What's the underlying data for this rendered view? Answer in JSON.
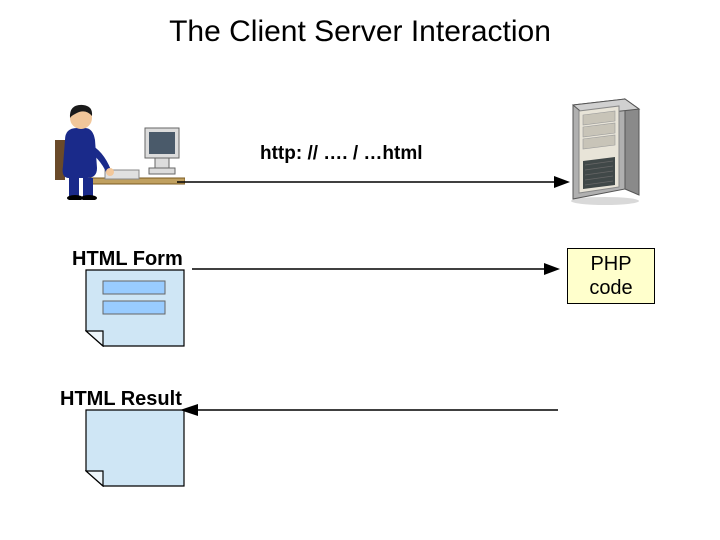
{
  "title": "The Client Server Interaction",
  "request_line": "http: // …. / …html",
  "labels": {
    "form": "HTML Form",
    "result": "HTML Result",
    "php1": "PHP",
    "php2": "code"
  },
  "colors": {
    "page_fill": "#cfe6f5",
    "field_fill": "#99ccff",
    "php_fill": "#ffffcc",
    "person_body": "#1a2a8a",
    "person_skin": "#f2c79a",
    "person_hair": "#1a1a1a",
    "monitor": "#dcdcdc",
    "screen": "#4a5a6a",
    "server_body": "#b0b0b0",
    "server_face": "#e8e4d8"
  }
}
